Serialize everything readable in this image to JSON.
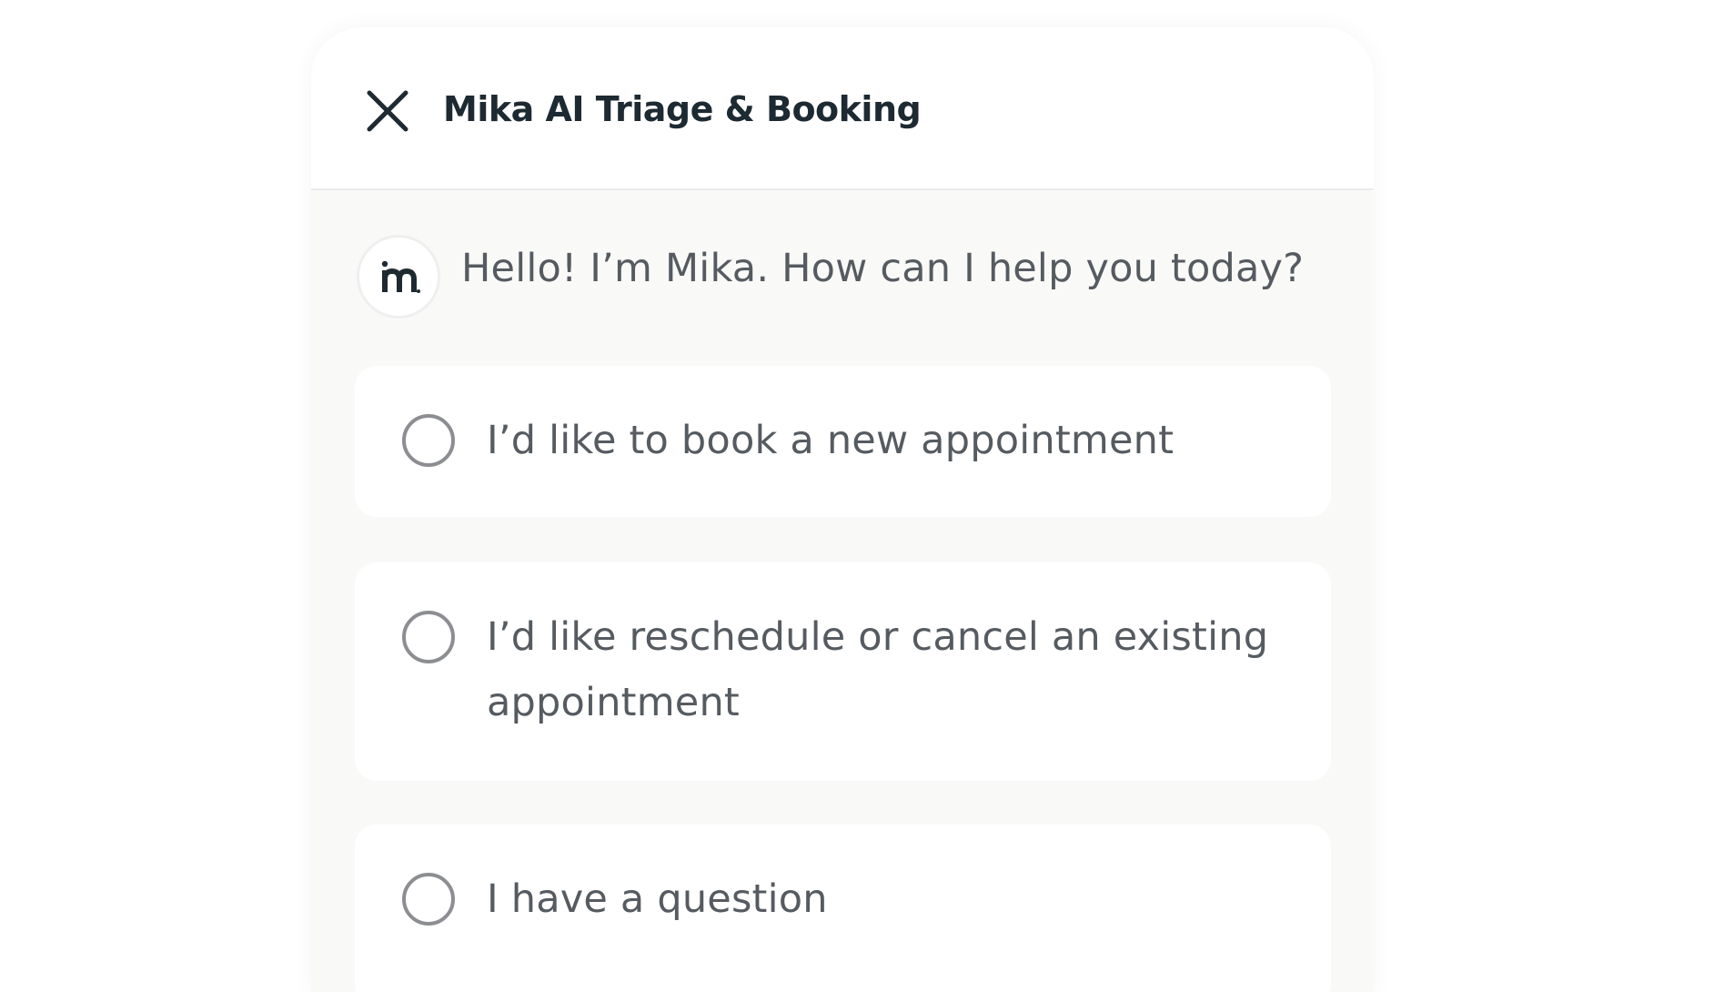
{
  "header": {
    "title": "Mika AI Triage & Booking",
    "close_icon": "close-icon"
  },
  "assistant": {
    "avatar_logo": "m.",
    "greeting": "Hello! I’m Mika. How can I help you today?"
  },
  "options": [
    {
      "label": "I’d like to book a new appointment",
      "selected": false
    },
    {
      "label": "I’d like reschedule or cancel an existing appointment",
      "selected": false
    },
    {
      "label": "I have a question",
      "selected": false
    }
  ],
  "colors": {
    "title_text": "#1e2a32",
    "body_text": "#555b60",
    "radio_border": "#8c8e91",
    "panel_background": "#f9f9f8",
    "card_background": "#ffffff"
  }
}
